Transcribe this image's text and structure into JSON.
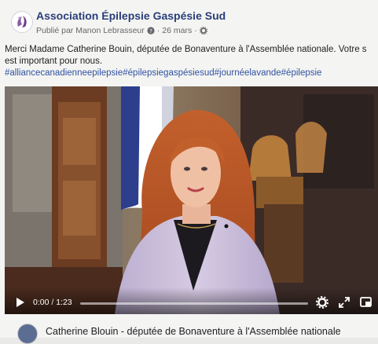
{
  "post": {
    "page_name": "Association Épilepsie Gaspésie Sud",
    "published_by": "Publié par Manon Lebrasseur",
    "date_separator": "·",
    "date": "26 mars",
    "date_separator_2": "·",
    "icons": [
      "question-circle-icon",
      "gear-icon"
    ],
    "text_line_1": "Merci Madame Catherine Bouin, députée de Bonaventure à l'Assemblée nationale. Votre s",
    "text_line_2": "est important pour nous.",
    "hashtags": "#alliancecanadienneepilepsie#épilepsiegaspésiesud#journéelavande#épilepsie"
  },
  "video": {
    "current_time": "0:00",
    "time_separator": "/",
    "duration": "1:23",
    "progress_fraction": 0.0,
    "control_icons": [
      "play-icon",
      "gear-icon",
      "expand-icon",
      "picture-in-picture-icon"
    ]
  },
  "next_post": {
    "author": "Catherine Blouin - députée de Bonaventure à l'Assemblée nationale"
  },
  "colors": {
    "page_name": "#2a3e7a",
    "hashtag": "#2f52a0",
    "background": "#f4f4f2"
  }
}
